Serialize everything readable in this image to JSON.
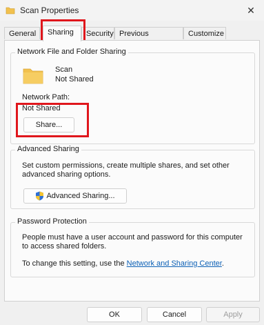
{
  "window": {
    "title": "Scan Properties"
  },
  "tabs": [
    {
      "label": "General"
    },
    {
      "label": "Sharing"
    },
    {
      "label": "Security"
    },
    {
      "label": "Previous Versions"
    },
    {
      "label": "Customize"
    }
  ],
  "network_sharing": {
    "group_title": "Network File and Folder Sharing",
    "folder_name": "Scan",
    "share_status": "Not Shared",
    "network_path_label": "Network Path:",
    "network_path_value": "Not Shared",
    "share_button": "Share..."
  },
  "advanced_sharing": {
    "group_title": "Advanced Sharing",
    "description": "Set custom permissions, create multiple shares, and set other advanced sharing options.",
    "button": "Advanced Sharing..."
  },
  "password_protection": {
    "group_title": "Password Protection",
    "description": "People must have a user account and password for this computer to access shared folders.",
    "change_prefix": "To change this setting, use the ",
    "link": "Network and Sharing Center",
    "change_suffix": "."
  },
  "footer": {
    "ok": "OK",
    "cancel": "Cancel",
    "apply": "Apply"
  },
  "colors": {
    "highlight": "#e0161c",
    "folder": "#f2c14e",
    "link": "#0a5fb5"
  }
}
